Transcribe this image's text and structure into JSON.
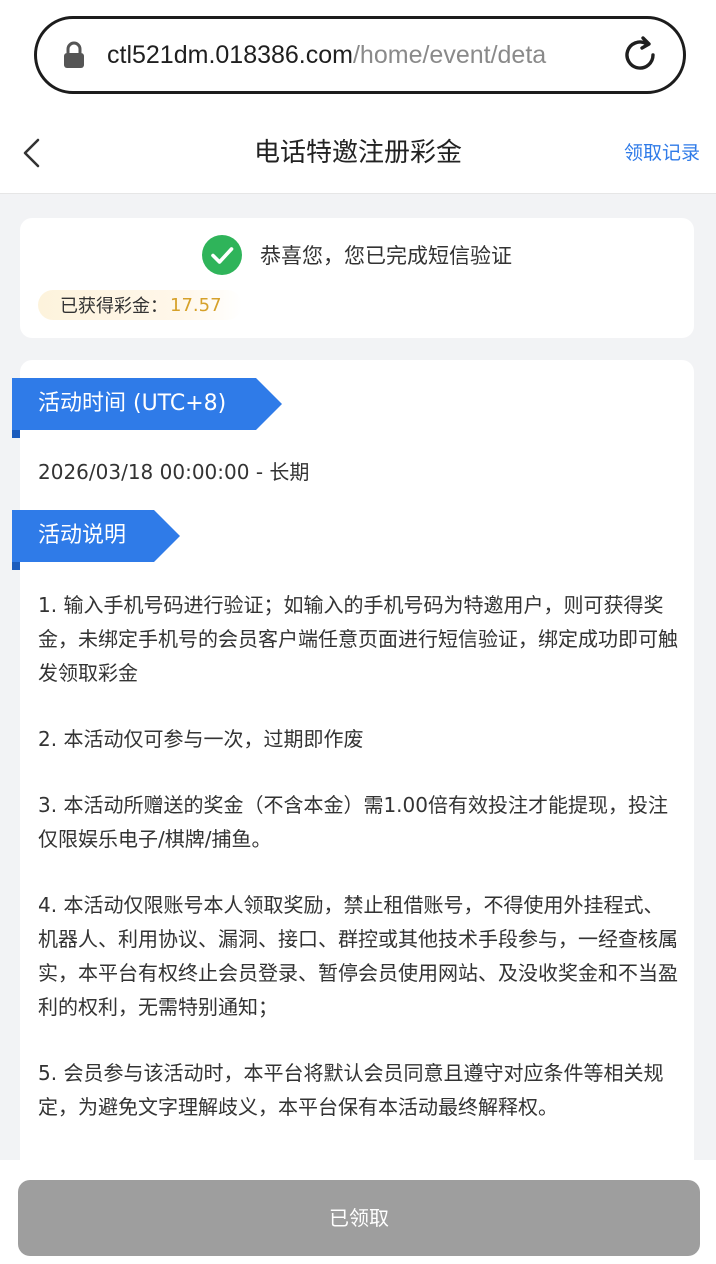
{
  "browser": {
    "url_host": "ctl521dm.018386.com",
    "url_path": "/home/event/deta"
  },
  "header": {
    "title": "电话特邀注册彩金",
    "records_label": "领取记录"
  },
  "status": {
    "message": "恭喜您，您已完成短信验证",
    "bonus_label": "已获得彩金：",
    "bonus_value": "17.57"
  },
  "activity": {
    "time_heading": "活动时间 (UTC+8)",
    "time_value": "2026/03/18 00:00:00 - 长期",
    "desc_heading": "活动说明",
    "rules": [
      "1. 输入手机号码进行验证；如输入的手机号码为特邀用户，则可获得奖金，未绑定手机号的会员客户端任意页面进行短信验证，绑定成功即可触发领取彩金",
      "2. 本活动仅可参与一次，过期即作废",
      "3. 本活动所赠送的奖金（不含本金）需1.00倍有效投注才能提现，投注仅限娱乐电子/棋牌/捕鱼。",
      "4. 本活动仅限账号本人领取奖励，禁止租借账号，不得使用外挂程式、机器人、利用协议、漏洞、接口、群控或其他技术手段参与，一经查核属实，本平台有权终止会员登录、暂停会员使用网站、及没收奖金和不当盈利的权利，无需特别通知；",
      "5. 会员参与该活动时，本平台将默认会员同意且遵守对应条件等相关规定，为避免文字理解歧义，本平台保有本活动最终解释权。"
    ]
  },
  "footer": {
    "button_label": "已领取"
  },
  "colors": {
    "accent": "#2f7be8",
    "success": "#2fb45a",
    "bonus": "#d6a12a",
    "disabled_button": "#9e9e9e"
  },
  "icons": [
    "lock-icon",
    "reload-icon",
    "back-icon",
    "check-circle-icon"
  ]
}
